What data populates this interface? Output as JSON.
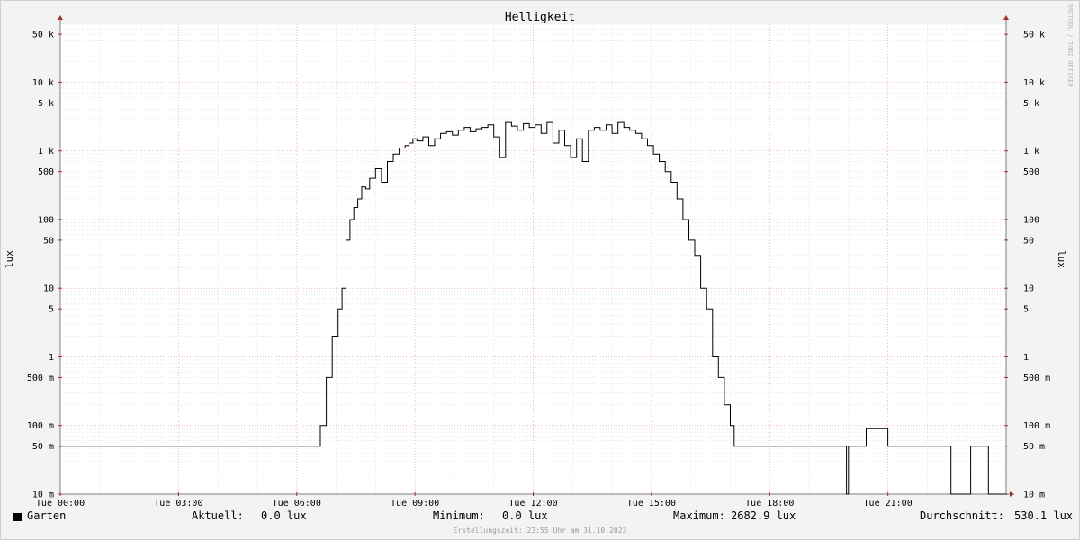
{
  "chart_data": {
    "type": "line",
    "title": "Helligkeit",
    "ylabel": "lux",
    "watermark": "RRDTOOL / TOBI OETIKER",
    "y_scale": "log",
    "ylim": [
      0.01,
      70000
    ],
    "xlim": [
      0,
      24
    ],
    "x_tick_hours": [
      0,
      3,
      6,
      9,
      12,
      15,
      18,
      21
    ],
    "x_tick_labels": [
      "Tue 00:00",
      "Tue 03:00",
      "Tue 06:00",
      "Tue 09:00",
      "Tue 12:00",
      "Tue 15:00",
      "Tue 18:00",
      "Tue 21:00"
    ],
    "y_tick_values": [
      0.01,
      0.05,
      0.1,
      0.5,
      1,
      5,
      10,
      50,
      100,
      500,
      1000,
      5000,
      10000,
      50000
    ],
    "y_tick_labels": [
      "10 m",
      "50 m",
      "100 m",
      "500 m",
      "1",
      "5",
      "10",
      "50",
      "100",
      "500",
      "1 k",
      "5 k",
      "10 k",
      "50 k"
    ],
    "grid": true,
    "series": [
      {
        "name": "Garten",
        "color": "#000000",
        "hours": [
          0,
          6.6,
          6.75,
          6.9,
          7.05,
          7.15,
          7.25,
          7.35,
          7.45,
          7.55,
          7.65,
          7.75,
          7.85,
          8.0,
          8.15,
          8.3,
          8.45,
          8.6,
          8.75,
          8.85,
          8.95,
          9.05,
          9.2,
          9.35,
          9.5,
          9.65,
          9.8,
          9.95,
          10.1,
          10.25,
          10.4,
          10.55,
          10.7,
          10.85,
          11.0,
          11.15,
          11.3,
          11.45,
          11.6,
          11.75,
          11.9,
          12.05,
          12.2,
          12.35,
          12.5,
          12.65,
          12.8,
          12.95,
          13.1,
          13.25,
          13.4,
          13.55,
          13.7,
          13.85,
          14.0,
          14.15,
          14.3,
          14.45,
          14.6,
          14.75,
          14.9,
          15.05,
          15.2,
          15.35,
          15.5,
          15.65,
          15.8,
          15.95,
          16.1,
          16.25,
          16.4,
          16.55,
          16.7,
          16.85,
          17.0,
          17.1,
          17.2,
          17.3,
          17.4,
          17.5,
          17.6,
          17.7,
          17.8,
          19.95,
          20.0,
          20.1,
          20.45,
          21.0,
          21.05,
          22.6,
          22.65,
          23.1,
          23.15,
          23.55,
          23.6,
          24
        ],
        "values": [
          0.05,
          0.1,
          0.5,
          2,
          5,
          10,
          50,
          100,
          150,
          200,
          300,
          280,
          400,
          550,
          350,
          700,
          900,
          1100,
          1200,
          1300,
          1500,
          1400,
          1600,
          1200,
          1500,
          1800,
          1900,
          1700,
          2000,
          2200,
          1900,
          2100,
          2200,
          2400,
          1600,
          800,
          2600,
          2300,
          2000,
          2500,
          2200,
          2400,
          1800,
          2600,
          1300,
          2000,
          1200,
          800,
          1500,
          700,
          2000,
          2200,
          2000,
          2400,
          1800,
          2600,
          2200,
          2000,
          1800,
          1500,
          1200,
          900,
          700,
          500,
          350,
          200,
          100,
          50,
          30,
          10,
          5,
          1,
          0.5,
          0.2,
          0.1,
          0.05,
          0.05,
          0.05,
          0.05,
          0.05,
          0.05,
          0.05,
          0.05,
          0.01,
          0.05,
          0.05,
          0.09,
          0.05,
          0.05,
          0.01,
          0.01,
          0.05,
          0.05,
          0.01,
          0.01,
          0.01
        ]
      }
    ]
  },
  "legend": {
    "series_name": "Garten",
    "current_label": "Aktuell:",
    "current_value": "0.0 lux",
    "minimum_label": "Minimum:",
    "minimum_value": "0.0 lux",
    "maximum_label": "Maximum:",
    "maximum_value": "2682.9 lux",
    "average_label": "Durchschnitt:",
    "average_value": "530.1 lux"
  },
  "footer": "Erstellungszeit: 23:55 Uhr am 31.10.2023",
  "colors": {
    "background": "#f3f3f3",
    "plot_background": "#ffffff",
    "major_grid": "#e8a0a0",
    "minor_grid": "#d8d8d8",
    "axis": "#7d7d7d",
    "arrow": "#a03030",
    "line": "#000000"
  }
}
